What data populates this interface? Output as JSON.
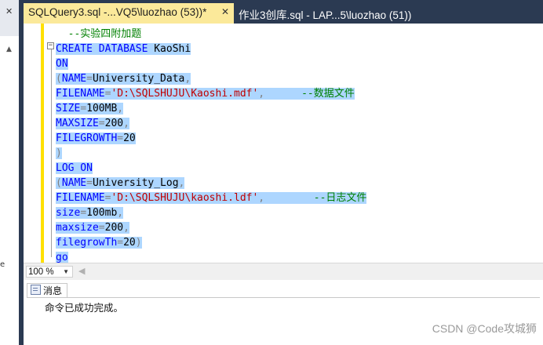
{
  "tabs": {
    "active_title": "SQLQuery3.sql -...VQ5\\luozhao (53))*",
    "close_glyph": "✕",
    "inactive_title": "作业3创库.sql - LAP...5\\luozhao (51))"
  },
  "side": {
    "close_glyph": "✕",
    "pin_glyph": "▲",
    "partial_text": "e"
  },
  "editor": {
    "lines": [
      {
        "selected": false,
        "tokens": [
          {
            "t": "  --实验四附加题",
            "c": "cm"
          }
        ]
      },
      {
        "selected": true,
        "tokens": [
          {
            "t": "CREATE DATABASE ",
            "c": "kw"
          },
          {
            "t": "KaoShi",
            "c": "tx"
          }
        ]
      },
      {
        "selected": true,
        "tokens": [
          {
            "t": "ON",
            "c": "kw"
          }
        ]
      },
      {
        "selected": true,
        "tokens": [
          {
            "t": "(",
            "c": "pn"
          },
          {
            "t": "NAME",
            "c": "kw"
          },
          {
            "t": "=",
            "c": "pn"
          },
          {
            "t": "University_Data",
            "c": "tx"
          },
          {
            "t": ",",
            "c": "pn"
          }
        ]
      },
      {
        "selected": true,
        "tokens": [
          {
            "t": "FILENAME",
            "c": "kw"
          },
          {
            "t": "=",
            "c": "pn"
          },
          {
            "t": "'D:\\SQLSHUJU\\Kaoshi.mdf'",
            "c": "str"
          },
          {
            "t": ",",
            "c": "pn"
          },
          {
            "t": "      --数据文件",
            "c": "cm"
          }
        ]
      },
      {
        "selected": true,
        "tokens": [
          {
            "t": "SIZE",
            "c": "kw"
          },
          {
            "t": "=",
            "c": "pn"
          },
          {
            "t": "100MB",
            "c": "tx"
          },
          {
            "t": ",",
            "c": "pn"
          }
        ]
      },
      {
        "selected": true,
        "tokens": [
          {
            "t": "MAXSIZE",
            "c": "kw"
          },
          {
            "t": "=",
            "c": "pn"
          },
          {
            "t": "200",
            "c": "tx"
          },
          {
            "t": ",",
            "c": "pn"
          }
        ]
      },
      {
        "selected": true,
        "tokens": [
          {
            "t": "FILEGROWTH",
            "c": "kw"
          },
          {
            "t": "=",
            "c": "pn"
          },
          {
            "t": "20",
            "c": "tx"
          }
        ]
      },
      {
        "selected": true,
        "tokens": [
          {
            "t": ")",
            "c": "pn"
          }
        ]
      },
      {
        "selected": true,
        "tokens": [
          {
            "t": "LOG ON",
            "c": "kw"
          }
        ]
      },
      {
        "selected": true,
        "tokens": [
          {
            "t": "(",
            "c": "pn"
          },
          {
            "t": "NAME",
            "c": "kw"
          },
          {
            "t": "=",
            "c": "pn"
          },
          {
            "t": "University_Log",
            "c": "tx"
          },
          {
            "t": ",",
            "c": "pn"
          }
        ]
      },
      {
        "selected": true,
        "tokens": [
          {
            "t": "FILENAME",
            "c": "kw"
          },
          {
            "t": "=",
            "c": "pn"
          },
          {
            "t": "'D:\\SQLSHUJU\\kaoshi.ldf'",
            "c": "str"
          },
          {
            "t": ",",
            "c": "pn"
          },
          {
            "t": "        --日志文件",
            "c": "cm"
          }
        ]
      },
      {
        "selected": true,
        "tokens": [
          {
            "t": "size",
            "c": "kw"
          },
          {
            "t": "=",
            "c": "pn"
          },
          {
            "t": "100mb",
            "c": "tx"
          },
          {
            "t": ",",
            "c": "pn"
          }
        ]
      },
      {
        "selected": true,
        "tokens": [
          {
            "t": "maxsize",
            "c": "kw"
          },
          {
            "t": "=",
            "c": "pn"
          },
          {
            "t": "200",
            "c": "tx"
          },
          {
            "t": ",",
            "c": "pn"
          }
        ]
      },
      {
        "selected": true,
        "tokens": [
          {
            "t": "filegrowTh",
            "c": "kw"
          },
          {
            "t": "=",
            "c": "pn"
          },
          {
            "t": "20",
            "c": "tx"
          },
          {
            "t": ")",
            "c": "pn"
          }
        ]
      },
      {
        "selected": true,
        "tokens": [
          {
            "t": "go",
            "c": "kw"
          }
        ]
      }
    ],
    "fold_glyph": "−"
  },
  "status": {
    "zoom": "100 %",
    "dropdown_glyph": "▼",
    "scroll_left_glyph": "◀"
  },
  "results": {
    "tab_label": "消息",
    "message": "命令已成功完成。"
  },
  "watermark": "CSDN @Code攻城狮"
}
